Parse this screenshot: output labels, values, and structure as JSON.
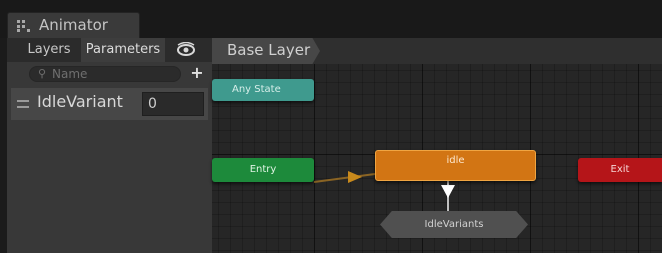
{
  "window": {
    "tab_title": "Animator",
    "tab_icon": "animator-icon"
  },
  "left_panel": {
    "tabs": [
      {
        "label": "Layers",
        "active": false
      },
      {
        "label": "Parameters",
        "active": true
      }
    ],
    "eye_icon": "eye-icon",
    "search": {
      "placeholder": "Name",
      "icon": "search-icon"
    },
    "add_button_label": "+",
    "parameters": [
      {
        "name": "IdleVariant",
        "value": "0"
      }
    ]
  },
  "graph": {
    "breadcrumb": "Base Layer",
    "nodes": {
      "any_state": "Any State",
      "entry": "Entry",
      "idle": "idle",
      "exit": "Exit",
      "sub_state_machine": "IdleVariants"
    }
  },
  "colors": {
    "any_state": "#3f9a8e",
    "entry": "#1d8a3b",
    "default_state": "#d27514",
    "exit": "#b51519",
    "transition": "#c98a1c"
  }
}
